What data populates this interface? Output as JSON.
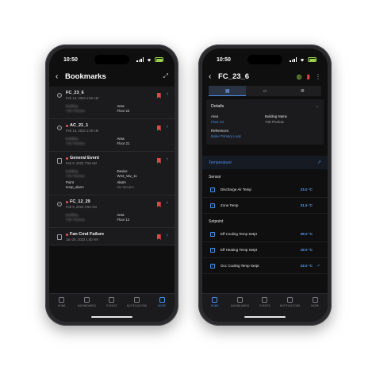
{
  "left": {
    "time": "10:50",
    "title": "Bookmarks",
    "cards": [
      {
        "name": "FC_23_6",
        "date": "Feb 13, 2023 1:50 AM",
        "kind": "equip",
        "alarm": false,
        "c1": [
          {
            "l": "Building",
            "v": "T45 Thurlow"
          }
        ],
        "c2": [
          {
            "l": "Area",
            "v": "Floor 23"
          }
        ]
      },
      {
        "name": "AC_21_1",
        "date": "Feb 13, 2023 1:49 AM",
        "kind": "equip",
        "alarm": true,
        "c1": [
          {
            "l": "Building",
            "v": "T45 Thurlow"
          }
        ],
        "c2": [
          {
            "l": "Area",
            "v": "Floor 21"
          }
        ]
      },
      {
        "name": "General Event",
        "date": "Feb 9, 2023 7:50 AM",
        "kind": "event",
        "alarm": true,
        "c1": [
          {
            "l": "Building",
            "v": "T45 Thurlow"
          },
          {
            "l": "Point",
            "v": "temp_alarm"
          }
        ],
        "c2": [
          {
            "l": "Device",
            "v": "W33_Vav_11"
          },
          {
            "l": "Alarm",
            "v": "56 minutes"
          }
        ]
      },
      {
        "name": "FC_12_29",
        "date": "Feb 9, 2023 4:50 AM",
        "kind": "equip",
        "alarm": true,
        "c1": [
          {
            "l": "Building",
            "v": "T45 Thurlow"
          }
        ],
        "c2": [
          {
            "l": "Area",
            "v": "Floor 12"
          }
        ]
      },
      {
        "name": "Fan Cmd Failure",
        "date": "Jan 25, 2023 1:50 AM",
        "kind": "event",
        "alarm": true,
        "c1": [],
        "c2": []
      }
    ],
    "tabs": [
      "HOME",
      "DASHBOARDS",
      "EVENTS",
      "NOTIFICATIONS",
      "MORE"
    ],
    "active_tab": 4
  },
  "right": {
    "time": "10:50",
    "title": "FC_23_6",
    "details": {
      "title": "Details",
      "area_label": "Area",
      "area_value": "Floor 23",
      "building_label": "Building Name",
      "building_value": "T45 Thurlow",
      "refs_label": "References",
      "refs_value": "Boiler Primary Loop"
    },
    "section": "Temperature",
    "sensor_label": "Sensor",
    "sensors": [
      {
        "name": "Discharge Air Temp",
        "value": "23.0 °C"
      },
      {
        "name": "Zone Temp",
        "value": "21.5 °C"
      }
    ],
    "setpoint_label": "Setpoint",
    "setpoints": [
      {
        "name": "Eff Cooling Temp Setpt",
        "value": "29.0 °C"
      },
      {
        "name": "Eff Heating Temp Setpt",
        "value": "19.0 °C"
      },
      {
        "name": "Occ Cooling Temp Setpt",
        "value": "24.0 °C",
        "trend": true
      }
    ],
    "tabs": [
      "HOME",
      "DASHBOARDS",
      "EVENTS",
      "NOTIFICATIONS",
      "MORE"
    ],
    "active_tab": 0
  },
  "colors": {
    "accent": "#4c8ee8",
    "bookmark": "#e04848",
    "status_ok": "#9ad04b"
  }
}
